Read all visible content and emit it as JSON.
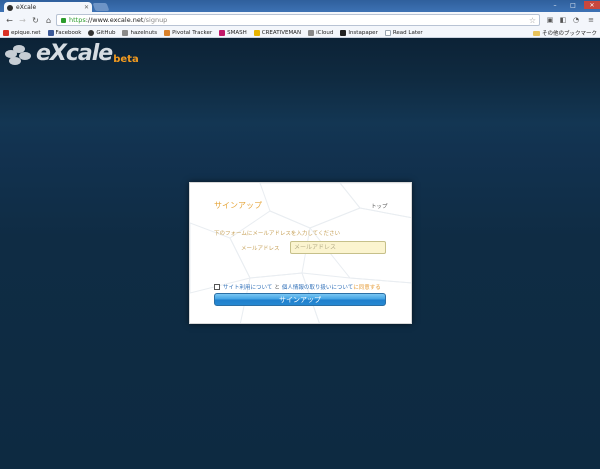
{
  "browser": {
    "tab_title": "eXcale",
    "url_https": "https",
    "url_host": "://www.excale.net",
    "url_path": "/signup",
    "bookmarks": [
      {
        "label": "epique.net",
        "color": "#d93025"
      },
      {
        "label": "Facebook",
        "color": "#3b5998"
      },
      {
        "label": "GitHub",
        "color": "#333333"
      },
      {
        "label": "hazelnuts",
        "color": "#8a8a8a"
      },
      {
        "label": "Pivotal Tracker",
        "color": "#d9812b"
      },
      {
        "label": "SMASH",
        "color": "#c2186a"
      },
      {
        "label": "CREATIVEMAN",
        "color": "#e8b400"
      },
      {
        "label": "iCloud",
        "color": "#888888"
      },
      {
        "label": "Instapaper",
        "color": "#222222"
      },
      {
        "label": "Read Later",
        "color": "#9aa5b1"
      }
    ],
    "other_bookmarks": "その他のブックマーク"
  },
  "site": {
    "logo_text": "eXcale",
    "logo_badge": "beta"
  },
  "signup": {
    "title": "サインアップ",
    "top_link": "トップ",
    "instruction": "下のフォームにメールアドレスを入力してください",
    "email_label": "メールアドレス",
    "email_placeholder": "メールアドレス",
    "terms_link": "サイト利用について",
    "and_text": "と",
    "privacy_link": "個人情報の取り扱いについて",
    "agree_text": "に同意する",
    "button_label": "サインアップ"
  }
}
